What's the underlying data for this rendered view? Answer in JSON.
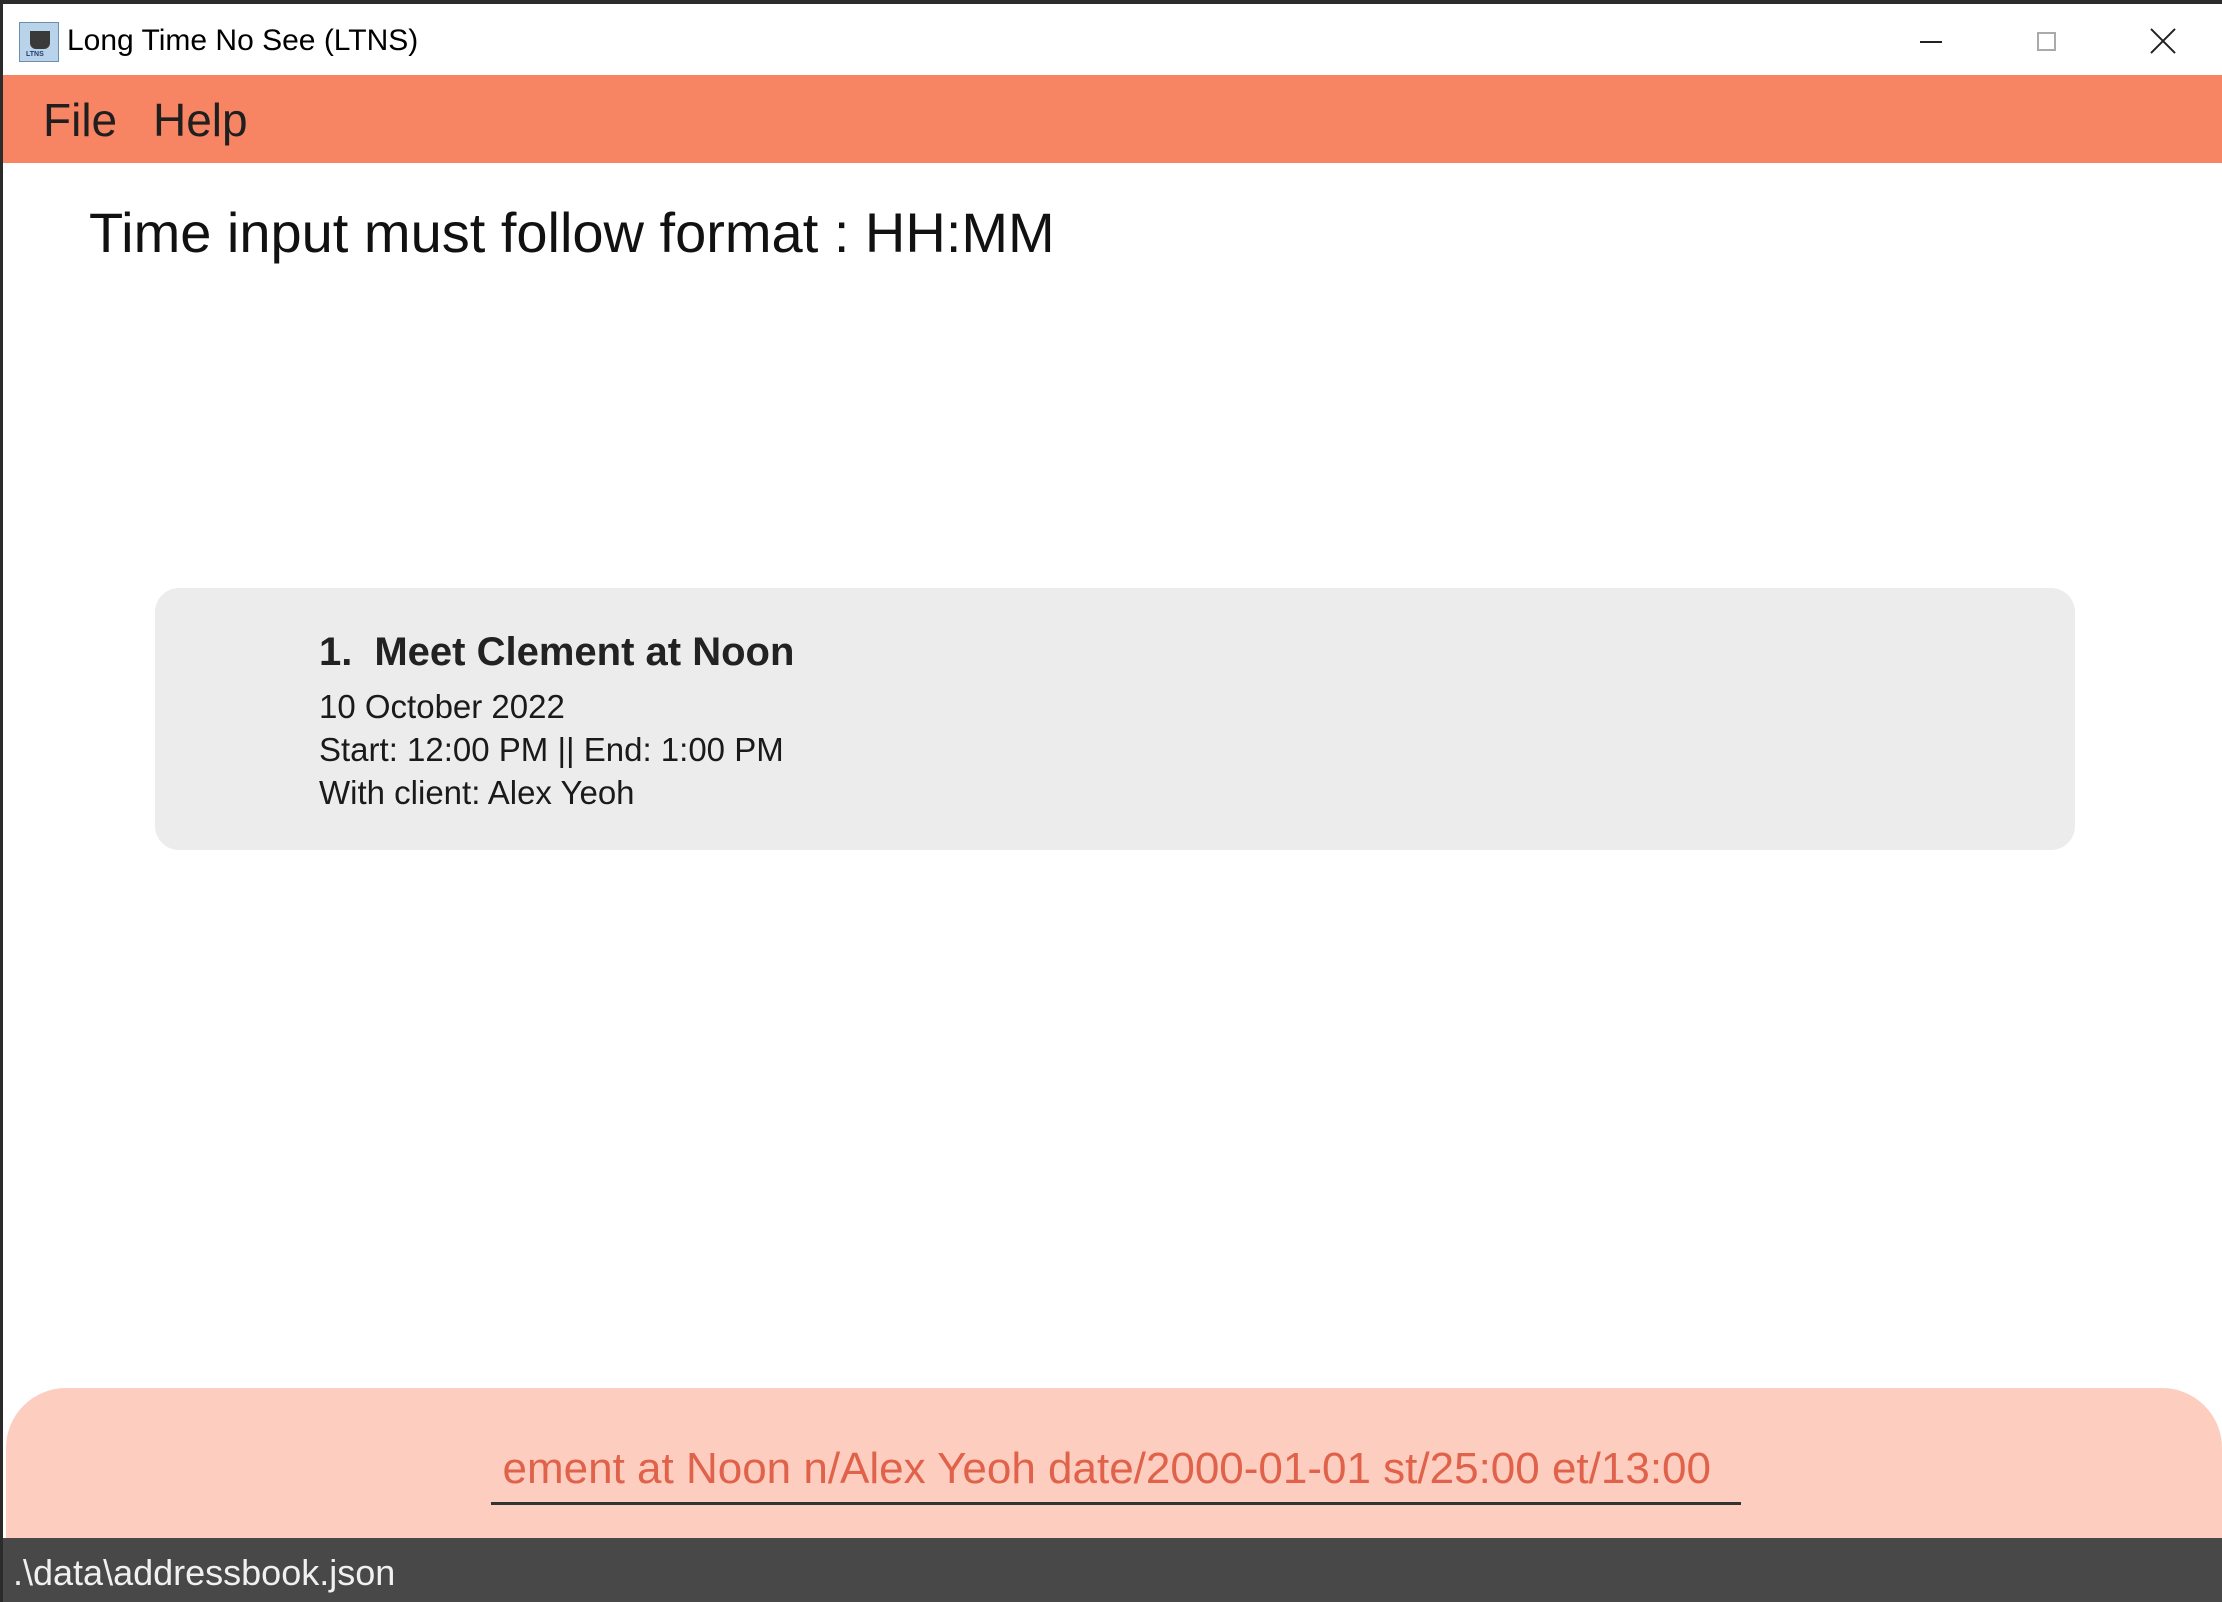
{
  "window": {
    "title": "Long Time No See (LTNS)",
    "icon_label": "LTNS"
  },
  "menu": {
    "file_label": "File",
    "help_label": "Help"
  },
  "result": {
    "message": "Time input must follow format : HH:MM"
  },
  "list": {
    "items": [
      {
        "index": "1.",
        "title": "Meet Clement at Noon",
        "date": "10 October 2022",
        "time": "Start: 12:00 PM || End: 1:00 PM",
        "client": "With client: Alex Yeoh"
      }
    ]
  },
  "command": {
    "value": "ement at Noon n/Alex Yeoh date/2000-01-01 st/25:00 et/13:00"
  },
  "status": {
    "path": ".\\data\\addressbook.json"
  },
  "colors": {
    "menubar": "#f78462",
    "command_area": "#fdcdc0",
    "command_text": "#e0624a",
    "card": "#ececec",
    "statusbar": "#484848"
  }
}
